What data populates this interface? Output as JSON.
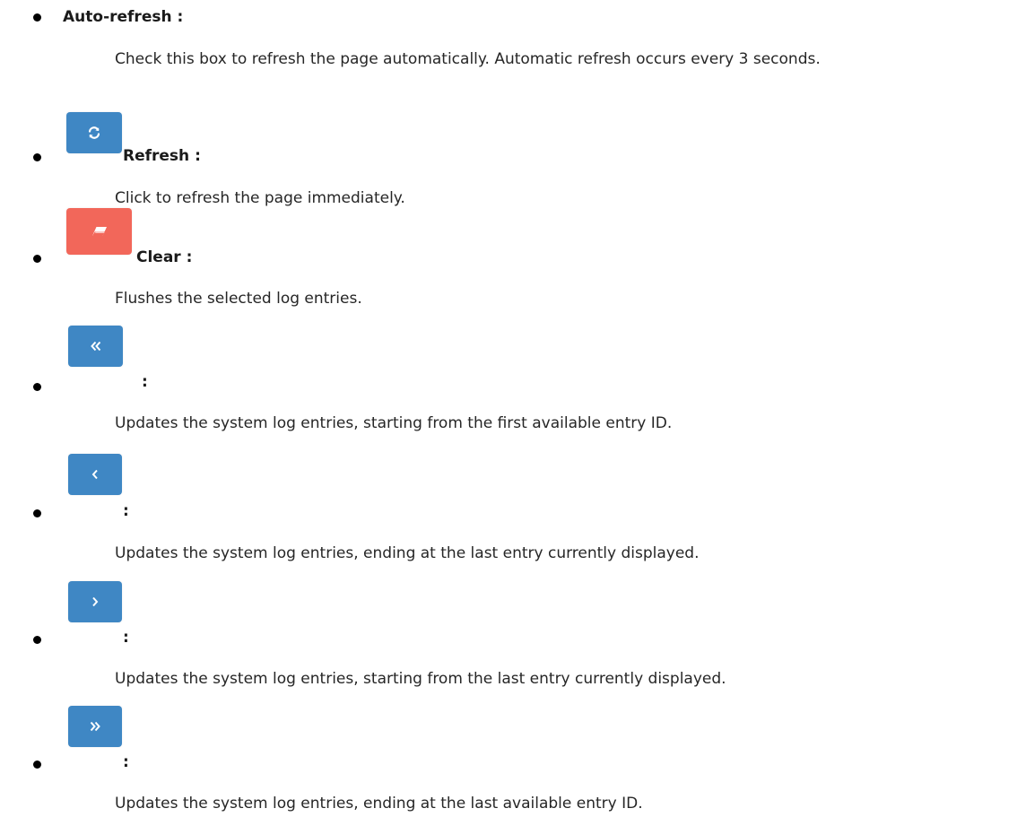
{
  "items": [
    {
      "title": "Auto-refresh :",
      "description": "Check this box to refresh the page automatically. Automatic refresh occurs every 3 seconds."
    },
    {
      "icon": "refresh-icon",
      "title": "Refresh :",
      "description": "Click to refresh the page immediately."
    },
    {
      "icon": "eraser-icon",
      "title": "Clear :",
      "description": "Flushes the selected log entries."
    },
    {
      "icon": "double-chevron-left-icon",
      "title": ":",
      "description": "Updates the system log entries, starting from the first available entry ID."
    },
    {
      "icon": "chevron-left-icon",
      "title": ":",
      "description": "Updates the system log entries, ending at the last entry currently displayed."
    },
    {
      "icon": "chevron-right-icon",
      "title": ":",
      "description": "Updates the system log entries, starting from the last entry currently displayed."
    },
    {
      "icon": "double-chevron-right-icon",
      "title": ":",
      "description": "Updates the system log entries, ending at the last available entry ID."
    }
  ],
  "colors": {
    "button_blue": "#3f87c4",
    "button_red": "#f2675a"
  }
}
